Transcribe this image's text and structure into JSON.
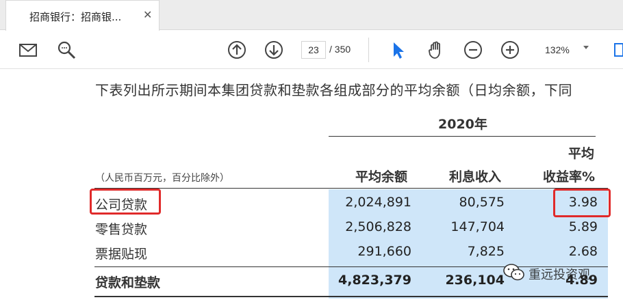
{
  "tab": {
    "title": "招商银行：招商银...",
    "close_glyph": "✕"
  },
  "toolbar": {
    "icons": [
      "mail-icon",
      "search-icon",
      "arrow-up-icon",
      "arrow-down-icon",
      "pointer-icon",
      "hand-icon",
      "zoom-out-icon",
      "zoom-in-icon"
    ],
    "current_page": "23",
    "page_total": "/ 350",
    "zoom": "132%"
  },
  "document": {
    "intro": "下表列出所示期间本集团贷款和垫款各组成部分的平均余额（日均余额，下同",
    "year": "2020年",
    "unit_note": "（人民币百万元，百分比除外）",
    "headers": {
      "avg_balance": "平均余额",
      "interest_income": "利息收入",
      "yield_line1": "平均",
      "yield_line2": "收益率%"
    },
    "rows": [
      {
        "label": "公司贷款",
        "avg_balance": "2,024,891",
        "interest_income": "80,575",
        "yield": "3.98"
      },
      {
        "label": "零售贷款",
        "avg_balance": "2,506,828",
        "interest_income": "147,704",
        "yield": "5.89"
      },
      {
        "label": "票据贴现",
        "avg_balance": "291,660",
        "interest_income": "7,825",
        "yield": "2.68"
      },
      {
        "label": "贷款和垫款",
        "avg_balance": "4,823,379",
        "interest_income": "236,104",
        "yield": "4.89"
      }
    ]
  },
  "watermark": {
    "text": "重远投资观"
  },
  "colors": {
    "highlight": "#cfe6f9",
    "annotation_red": "#e02a2a",
    "pointer_blue": "#1a73e8"
  }
}
